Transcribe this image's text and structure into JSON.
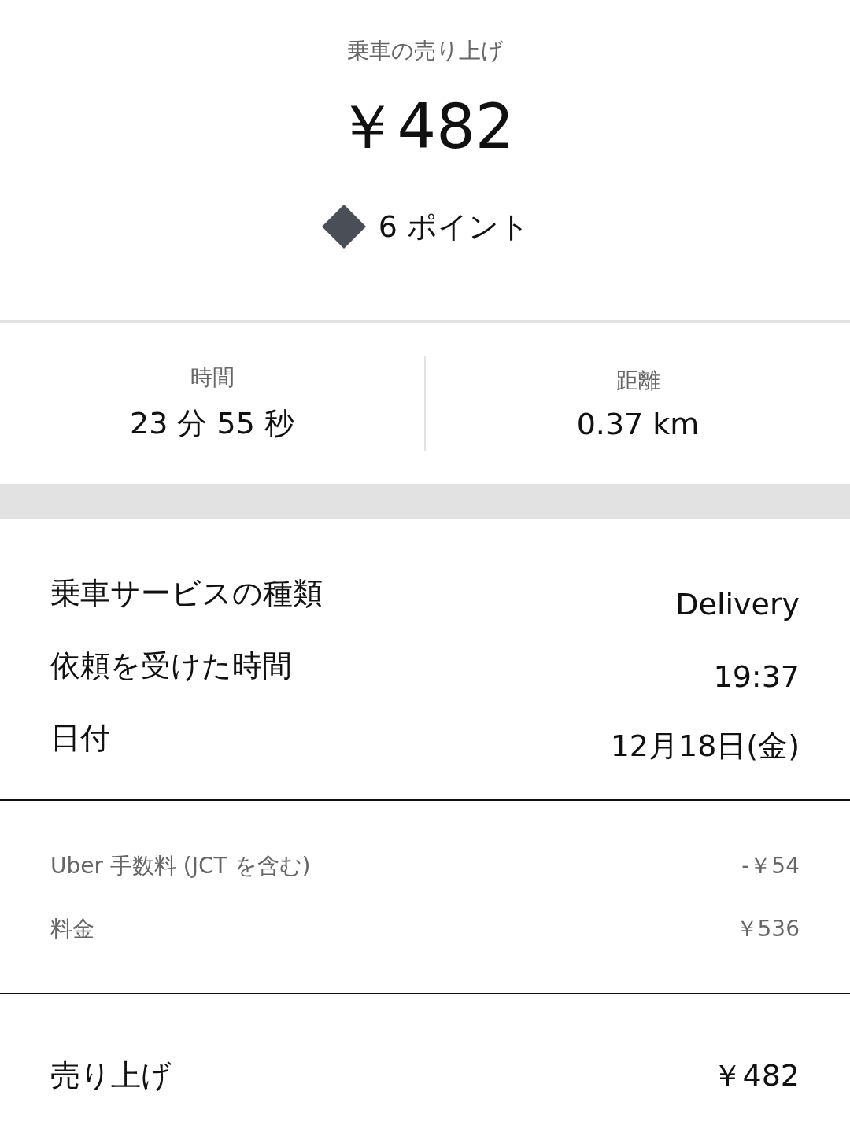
{
  "header": {
    "title": "乗車の売り上げ",
    "amount": "￥482",
    "points": "6 ポイント"
  },
  "stats": [
    {
      "label": "時間",
      "value": "23 分 55 秒"
    },
    {
      "label": "距離",
      "value": "0.37 km"
    }
  ],
  "details": [
    {
      "label": "乗車サービスの種類",
      "value": "Delivery"
    },
    {
      "label": "依頼を受けた時間",
      "value": "19:37"
    },
    {
      "label": "日付",
      "value": "12月18日(金)"
    }
  ],
  "fees": [
    {
      "label": "Uber 手数料 (JCT を含む)",
      "value": "-￥54"
    },
    {
      "label": "料金",
      "value": "￥536"
    }
  ],
  "total": {
    "label": "売り上げ",
    "value": "￥482"
  }
}
